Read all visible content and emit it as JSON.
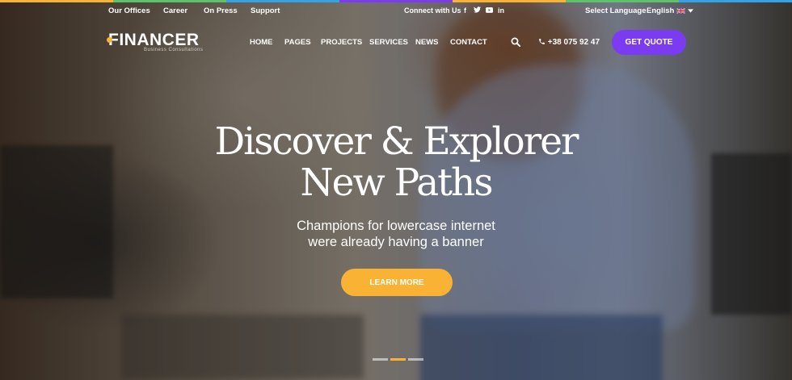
{
  "colors": {
    "accent_purple": "#7b3cf1",
    "accent_yellow": "#f9b233",
    "strip": [
      "#f9b233",
      "#5ec26a",
      "#33a3e5",
      "#7b3cf1",
      "#f9b233",
      "#5ec26a",
      "#33a3e5"
    ]
  },
  "topbar": {
    "links": [
      "Our Offices",
      "Career",
      "On Press",
      "Support"
    ],
    "connect_label": "Connect with Us",
    "social_icons": [
      "facebook-icon",
      "twitter-icon",
      "youtube-icon",
      "linkedin-icon"
    ],
    "language_label": "Select Language",
    "language_value": "English"
  },
  "logo": {
    "name": "FINANCER",
    "tagline": "Business Consultations"
  },
  "nav": {
    "items": [
      "HOME",
      "PAGES",
      "PROJECTS",
      "SERVICES",
      "NEWS",
      "CONTACT"
    ],
    "phone": "+38 075 92 47",
    "cta": "GET QUOTE"
  },
  "hero": {
    "title_line1": "Discover & Explorer",
    "title_line2": "New Paths",
    "subtitle_line1": "Champions for lowercase internet",
    "subtitle_line2": "were already having a banner",
    "button": "LEARN MORE",
    "slides_total": 3,
    "slide_active": 2
  }
}
